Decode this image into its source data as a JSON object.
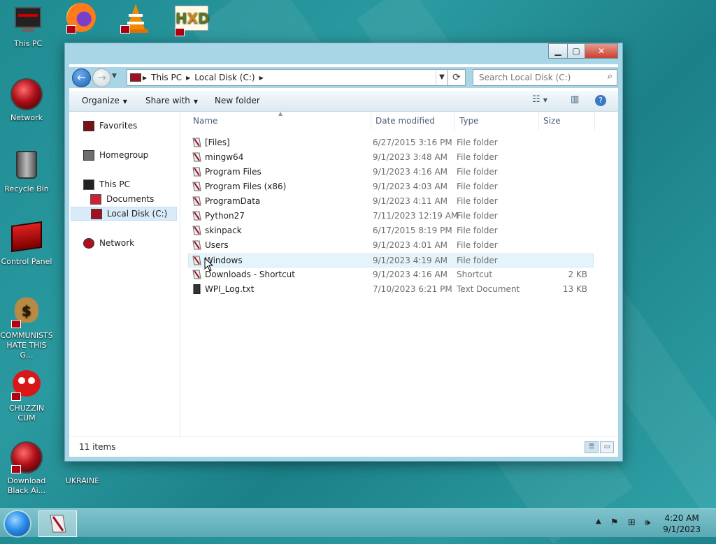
{
  "desktop": {
    "icons": [
      {
        "label": "This PC"
      },
      {
        "label": "Network"
      },
      {
        "label": "Recycle Bin"
      },
      {
        "label": "Control Panel"
      },
      {
        "label": "COMMUNISTS HATE THIS G..."
      },
      {
        "label": "CHUZZIN CUM"
      },
      {
        "label": "Download Black Ai..."
      },
      {
        "label": "UKRAINE"
      }
    ]
  },
  "window": {
    "breadcrumb": [
      "This PC",
      "Local Disk (C:)"
    ],
    "search_placeholder": "Search Local Disk (C:)",
    "toolbar": {
      "organize": "Organize",
      "share_with": "Share with",
      "new_folder": "New folder"
    },
    "nav": {
      "favorites": "Favorites",
      "homegroup": "Homegroup",
      "this_pc": "This PC",
      "documents": "Documents",
      "local_disk": "Local Disk (C:)",
      "network": "Network"
    },
    "columns": {
      "name": "Name",
      "date": "Date modified",
      "type": "Type",
      "size": "Size"
    },
    "files": [
      {
        "name": "[Files]",
        "date": "6/27/2015 3:16 PM",
        "type": "File folder",
        "size": ""
      },
      {
        "name": "mingw64",
        "date": "9/1/2023 3:48 AM",
        "type": "File folder",
        "size": ""
      },
      {
        "name": "Program Files",
        "date": "9/1/2023 4:16 AM",
        "type": "File folder",
        "size": ""
      },
      {
        "name": "Program Files (x86)",
        "date": "9/1/2023 4:03 AM",
        "type": "File folder",
        "size": ""
      },
      {
        "name": "ProgramData",
        "date": "9/1/2023 4:11 AM",
        "type": "File folder",
        "size": ""
      },
      {
        "name": "Python27",
        "date": "7/11/2023 12:19 AM",
        "type": "File folder",
        "size": ""
      },
      {
        "name": "skinpack",
        "date": "6/17/2015 8:19 PM",
        "type": "File folder",
        "size": ""
      },
      {
        "name": "Users",
        "date": "9/1/2023 4:01 AM",
        "type": "File folder",
        "size": ""
      },
      {
        "name": "Windows",
        "date": "9/1/2023 4:19 AM",
        "type": "File folder",
        "size": ""
      },
      {
        "name": "Downloads - Shortcut",
        "date": "9/1/2023 4:16 AM",
        "type": "Shortcut",
        "size": "2 KB"
      },
      {
        "name": "WPI_Log.txt",
        "date": "7/10/2023 6:21 PM",
        "type": "Text Document",
        "size": "13 KB"
      }
    ],
    "status": {
      "count": "11 items"
    }
  },
  "taskbar": {
    "time": "4:20 AM",
    "date": "9/1/2023"
  },
  "colors": {
    "desktop_teal": "#1f8b92",
    "selection_blue": "#d9ebf9",
    "close_red": "#c9412f"
  }
}
